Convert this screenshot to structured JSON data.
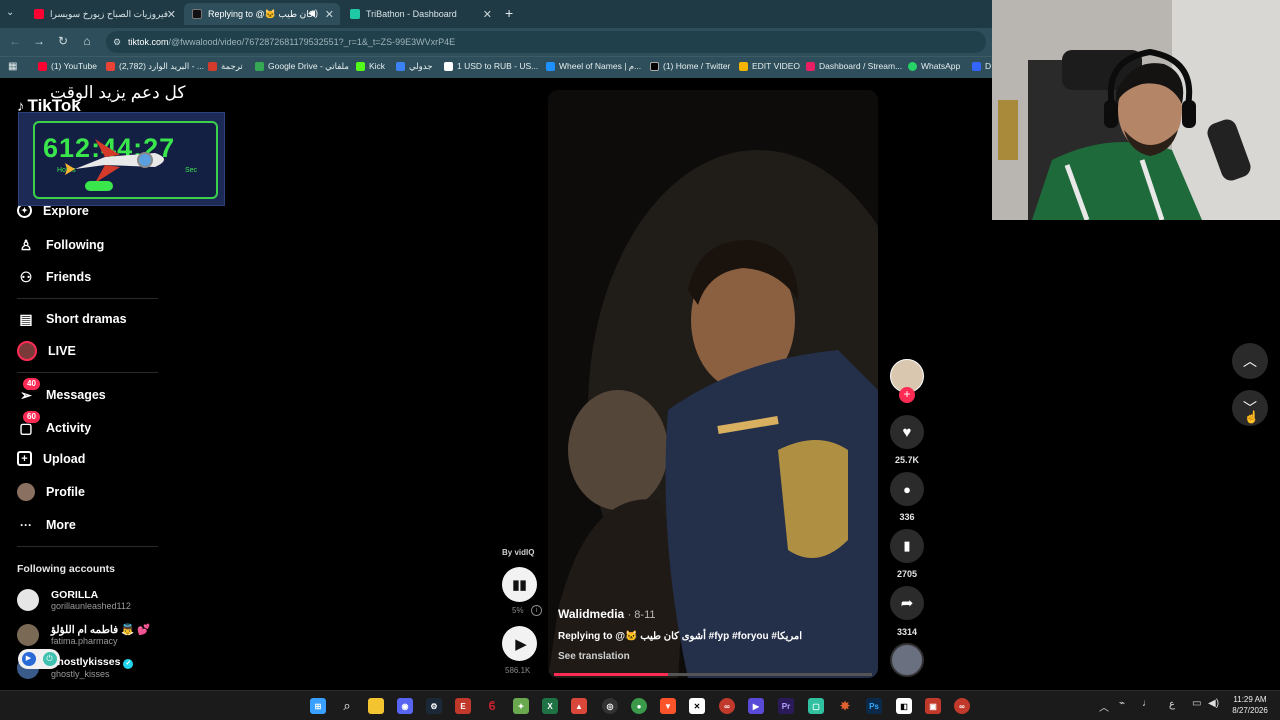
{
  "browser": {
    "tabs": [
      {
        "label": "فيروزيات الصباح زيورخ سويسرا",
        "color": "#ff0033",
        "icon": "youtube-icon"
      },
      {
        "label": "Replying to @🐱 كان طيب",
        "color": "#111111",
        "icon": "tiktok-icon"
      },
      {
        "label": "TriBathon - Dashboard",
        "color": "#20c9a6",
        "icon": "tribathon-icon"
      }
    ],
    "url_host": "tiktok.com",
    "url_path": "/@fwwalood/video/7672872681179532551?_r=1&_t=ZS-99E3WVxrP4E",
    "bookmarks": [
      {
        "label": "(1) YouTube",
        "color": "#ff0033"
      },
      {
        "label": "(2,782) البريد الوارد - ...",
        "color": "#ea4335"
      },
      {
        "label": "ترجمة",
        "color": "#4285f4"
      },
      {
        "label": "Google Drive - ملفاتي",
        "color": "#34a853"
      },
      {
        "label": "Kick",
        "color": "#53fc18"
      },
      {
        "label": "جدولي",
        "color": "#3b82f6"
      },
      {
        "label": "1 USD to RUB - US...",
        "color": "#ffffff"
      },
      {
        "label": "Wheel of Names | م...",
        "color": "#1e90ff"
      },
      {
        "label": "(1) Home / Twitter",
        "color": "#000000"
      },
      {
        "label": "EDIT VIDEO",
        "color": "#f4b400"
      },
      {
        "label": "Dashboard / Stream...",
        "color": "#e91e63"
      },
      {
        "label": "WhatsApp",
        "color": "#25d366"
      },
      {
        "label": "D",
        "color": "#3366ff"
      }
    ]
  },
  "overlay": {
    "caption_arabic": "كل دعم يزيد الوقت",
    "timer": {
      "h": "612",
      "m": "44",
      "s": "27",
      "h_label": "Hours",
      "s_label": "Sec"
    }
  },
  "sidebar": {
    "logo": "TikTok",
    "nav": [
      {
        "label": "Explore",
        "icon": "compass-icon",
        "glyph": "⊘"
      },
      {
        "label": "Following",
        "icon": "following-icon",
        "glyph": "⚇"
      },
      {
        "label": "Friends",
        "icon": "friends-icon",
        "glyph": "⚇"
      }
    ],
    "nav2": [
      {
        "label": "Short dramas",
        "icon": "film-icon",
        "glyph": "▤"
      },
      {
        "label": "LIVE",
        "icon": "live-icon",
        "glyph": "●"
      }
    ],
    "nav3": [
      {
        "label": "Messages",
        "icon": "send-icon",
        "glyph": "➢",
        "badge": "40"
      },
      {
        "label": "Activity",
        "icon": "activity-icon",
        "glyph": "▢",
        "badge": "60"
      },
      {
        "label": "Upload",
        "icon": "upload-icon",
        "glyph": "⊞"
      },
      {
        "label": "Profile",
        "icon": "avatar",
        "glyph": ""
      },
      {
        "label": "More",
        "icon": "more-icon",
        "glyph": "···"
      }
    ],
    "following_title": "Following accounts",
    "accounts": [
      {
        "name": "GORILLA",
        "handle": "gorillaunleashed112",
        "color": "#e6e6e6"
      },
      {
        "name": "فاطمه ام اللؤلؤ 👼 💕",
        "handle": "fatima.pharmacy",
        "color": "#7a6a55"
      },
      {
        "name": "ghostlykisses",
        "handle": "ghostly_kisses",
        "color": "#3a5a8a"
      }
    ]
  },
  "video": {
    "vidiq_label": "By vidIQ",
    "vidiq_percent": "5%",
    "play_count": "586.1K",
    "author": "Walidmedia",
    "date": "· 8-11",
    "caption": "Replying to @🐱 أشوى كان طيب  #fyp #foryou #امريكا",
    "see_translation": "See translation",
    "progress": 0.36
  },
  "actions": {
    "likes": "25.7K",
    "comments": "336",
    "saves": "2705",
    "shares": "3314"
  },
  "taskbar": {
    "lang": "ع",
    "time": "11:29 AM",
    "date": "8/27/2026"
  }
}
